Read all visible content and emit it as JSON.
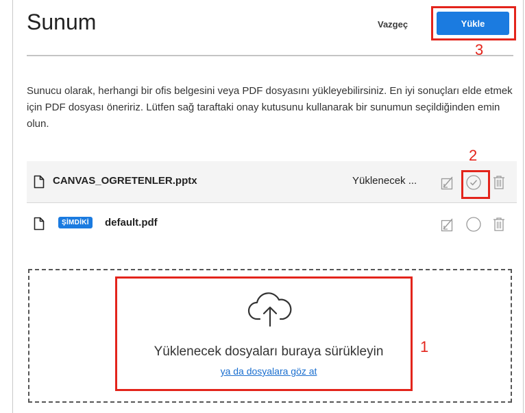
{
  "header": {
    "title": "Sunum",
    "cancel_label": "Vazgeç",
    "upload_label": "Yükle"
  },
  "description": "Sunucu olarak, herhangi bir ofis belgesini veya PDF dosyasını yükleyebilirsiniz. En iyi sonuçları elde etmek için PDF dosyası öneririz. Lütfen sağ taraftaki onay kutusunu kullanarak bir sunumun seçildiğinden emin olun.",
  "files": [
    {
      "name": "CANVAS_OGRETENLER.pptx",
      "status": "Yüklenecek ...",
      "badge": "",
      "selected": true
    },
    {
      "name": "default.pdf",
      "status": "",
      "badge": "ŞİMDİKİ",
      "selected": false
    }
  ],
  "dropzone": {
    "text": "Yüklenecek dosyaları buraya sürükleyin",
    "browse_link": "ya da dosyalara göz at"
  },
  "annotations": [
    "1",
    "2",
    "3"
  ],
  "colors": {
    "accent": "#1b7be0",
    "annotation": "#e3241b"
  }
}
